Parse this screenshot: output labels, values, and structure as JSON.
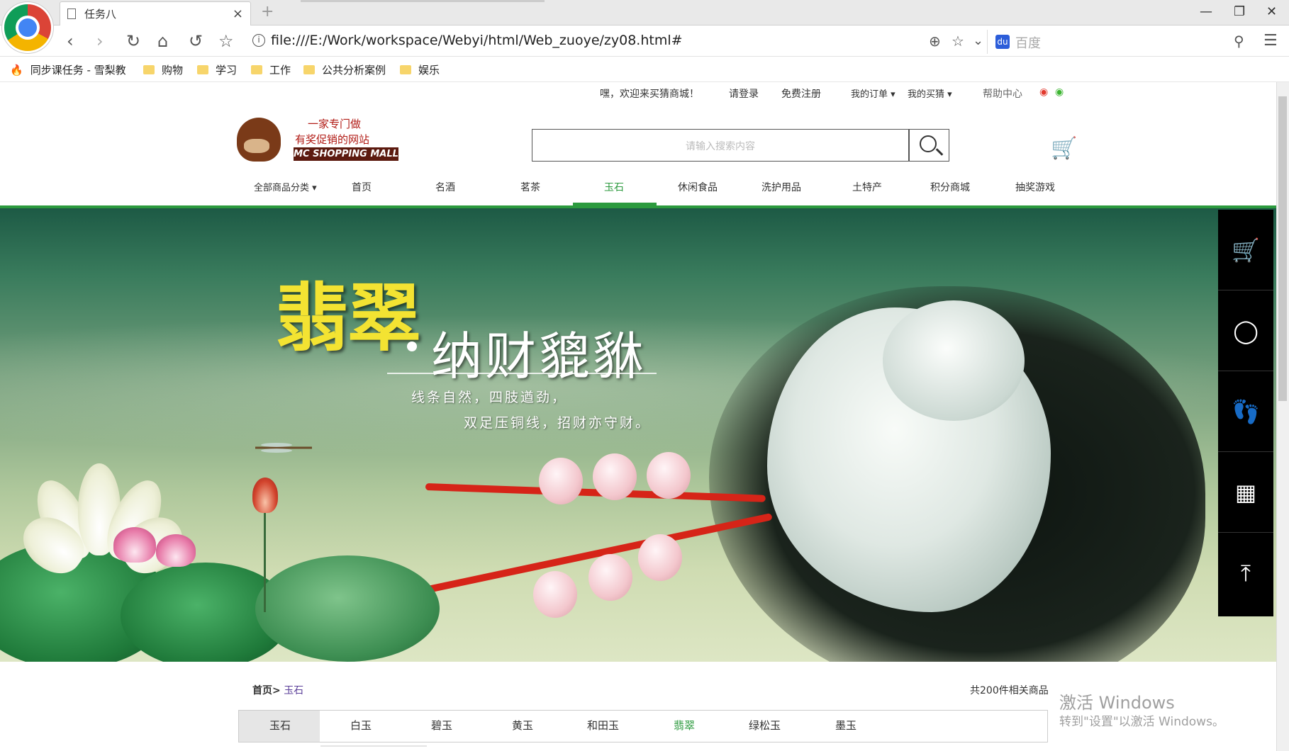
{
  "browser": {
    "tab_title": "任务八",
    "tab_close": "×",
    "new_tab": "+",
    "address": "file:///E:/Work/workspace/Webyi/html/Web_zuoye/zy08.html#",
    "search_engine": "百度",
    "bookmarks": [
      {
        "label": "同步课任务 - 雪梨教"
      },
      {
        "label": "购物"
      },
      {
        "label": "学习"
      },
      {
        "label": "工作"
      },
      {
        "label": "公共分析案例"
      },
      {
        "label": "娱乐"
      }
    ]
  },
  "site": {
    "topbar": {
      "welcome": "嘿，欢迎来买猜商城！",
      "login": "请登录",
      "register": "免费注册",
      "my_orders": "我的订单 ▾",
      "my_guess": "我的买猜 ▾",
      "help": "帮助中心"
    },
    "logo": {
      "line1": "一家专门做",
      "line2": "有奖促销的网站",
      "en": "MC SHOPPING MALL"
    },
    "search": {
      "placeholder": "请输入搜索内容"
    },
    "nav": {
      "all_categories": "全部商品分类 ▾",
      "items": [
        "首页",
        "名酒",
        "茗茶",
        "玉石",
        "休闲食品",
        "洗护用品",
        "土特产",
        "积分商城",
        "抽奖游戏"
      ],
      "active": "玉石"
    },
    "banner": {
      "title_main": "翡翠",
      "title_sub": "纳财貔貅",
      "line1": "线条自然，四肢遒劲，",
      "line2": "双足压铜线，招财亦守财。"
    },
    "breadcrumb": {
      "home": "首页>",
      "current": "玉石"
    },
    "total": "共200件相关商品",
    "subtabs": {
      "items": [
        "玉石",
        "白玉",
        "碧玉",
        "黄玉",
        "和田玉",
        "翡翠",
        "绿松玉",
        "墨玉"
      ],
      "active": "玉石",
      "highlight": "翡翠"
    },
    "side_tools": [
      "cart-icon",
      "qq-icon",
      "footprint-icon",
      "qrcode-icon",
      "back-to-top-icon"
    ]
  },
  "os_watermark": {
    "line1": "激活 Windows",
    "line2": "转到\"设置\"以激活 Windows。"
  },
  "colors": {
    "accent_green": "#2c9a3e",
    "cart_red": "#e7322a",
    "highlight_green": "#2c9a3e"
  }
}
